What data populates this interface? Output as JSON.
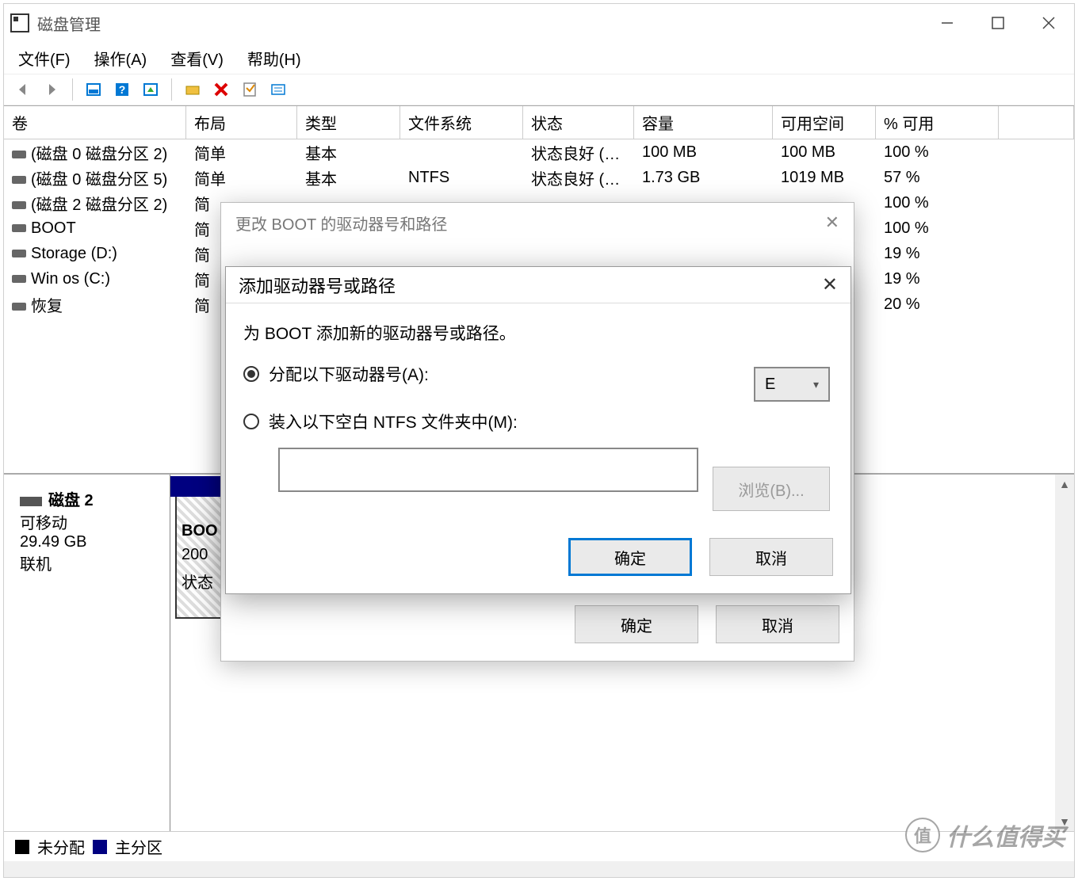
{
  "window": {
    "title": "磁盘管理"
  },
  "menu": {
    "file": "文件(F)",
    "action": "操作(A)",
    "view": "查看(V)",
    "help": "帮助(H)"
  },
  "table": {
    "headers": {
      "volume": "卷",
      "layout": "布局",
      "type": "类型",
      "filesystem": "文件系统",
      "status": "状态",
      "capacity": "容量",
      "free": "可用空间",
      "pct": "% 可用"
    },
    "rows": [
      {
        "volume": "(磁盘 0 磁盘分区 2)",
        "layout": "简单",
        "type": "基本",
        "fs": "",
        "status": "状态良好 (…",
        "cap": "100 MB",
        "free": "100 MB",
        "pct": "100 %"
      },
      {
        "volume": "(磁盘 0 磁盘分区 5)",
        "layout": "简单",
        "type": "基本",
        "fs": "NTFS",
        "status": "状态良好 (…",
        "cap": "1.73 GB",
        "free": "1019 MB",
        "pct": "57 %"
      },
      {
        "volume": "(磁盘 2 磁盘分区 2)",
        "layout": "简",
        "type": "",
        "fs": "",
        "status": "",
        "cap": "",
        "free": "",
        "pct": "100 %"
      },
      {
        "volume": "BOOT",
        "layout": "简",
        "type": "",
        "fs": "",
        "status": "",
        "cap": "",
        "free": "",
        "pct": "100 %"
      },
      {
        "volume": "Storage (D:)",
        "layout": "简",
        "type": "",
        "fs": "",
        "status": "",
        "cap": "",
        "free": "",
        "pct": "19 %"
      },
      {
        "volume": "Win os  (C:)",
        "layout": "简",
        "type": "",
        "fs": "",
        "status": "",
        "cap": "",
        "free": "",
        "pct": "19 %"
      },
      {
        "volume": "恢复",
        "layout": "简",
        "type": "",
        "fs": "",
        "status": "",
        "cap": "",
        "free": "",
        "pct": "20 %"
      }
    ]
  },
  "disk_panel": {
    "name": "磁盘 2",
    "removable": "可移动",
    "size": "29.49 GB",
    "online": "联机",
    "partition": {
      "name": "BOO",
      "size": "200",
      "status": "状态"
    }
  },
  "legend": {
    "unallocated": "未分配",
    "primary": "主分区"
  },
  "parent_dialog": {
    "title": "更改 BOOT 的驱动器号和路径",
    "ok": "确定",
    "cancel": "取消"
  },
  "front_dialog": {
    "title": "添加驱动器号或路径",
    "instruction": "为 BOOT 添加新的驱动器号或路径。",
    "opt_assign": "分配以下驱动器号(A):",
    "opt_mount": "装入以下空白 NTFS 文件夹中(M):",
    "drive_letter": "E",
    "browse": "浏览(B)...",
    "ok": "确定",
    "cancel": "取消"
  },
  "watermark": "什么值得买"
}
